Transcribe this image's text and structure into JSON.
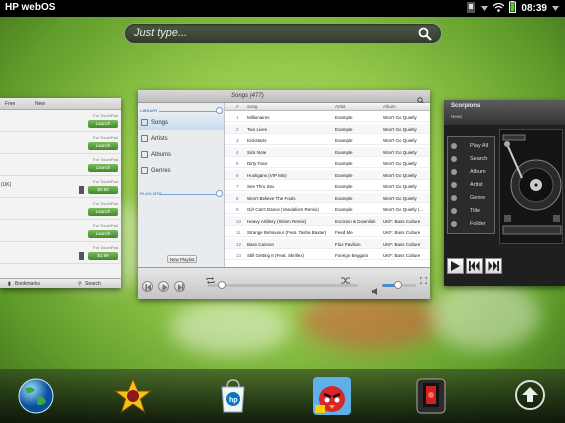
{
  "status_bar": {
    "title": "HP webOS",
    "time": "08:39"
  },
  "search": {
    "placeholder": "Just type..."
  },
  "left_card": {
    "tabs": [
      "Free",
      "New"
    ],
    "rows": [
      {
        "price": "For TouchPad",
        "button": "Launch",
        "side": ""
      },
      {
        "price": "For TouchPad",
        "button": "Launch",
        "side": ""
      },
      {
        "price": "For TouchPad",
        "button": "Launch",
        "side": ""
      },
      {
        "price": "For TouchPad",
        "button": "$0.99",
        "side": "(UK)"
      },
      {
        "price": "For TouchPad",
        "button": "Launch",
        "side": ""
      },
      {
        "price": "For TouchPad",
        "button": "Launch",
        "side": ""
      },
      {
        "price": "For TouchPad",
        "button": "$1.99",
        "side": ""
      }
    ],
    "footer": {
      "bookmarks": "Bookmarks",
      "search": "Search"
    }
  },
  "music": {
    "title": "Songs (477)",
    "sections": {
      "library": "LIBRARY",
      "playlists": "PLAYLISTS"
    },
    "nav": [
      "Songs",
      "Artists",
      "Albums",
      "Genres"
    ],
    "new_playlist": "New Playlist",
    "columns": {
      "num": "#",
      "song": "Song",
      "artist": "Artist",
      "album": "Album"
    },
    "songs": [
      {
        "num": "1",
        "song": "Millionaires",
        "artist": "Example",
        "album": "Won't Go Quietly"
      },
      {
        "num": "2",
        "song": "Two Lives",
        "artist": "Example",
        "album": "Won't Go Quietly"
      },
      {
        "num": "3",
        "song": "Kickstarts",
        "artist": "Example",
        "album": "Won't Go Quietly"
      },
      {
        "num": "4",
        "song": "Sick Note",
        "artist": "Example",
        "album": "Won't Go Quietly"
      },
      {
        "num": "5",
        "song": "Dirty Face",
        "artist": "Example",
        "album": "Won't Go Quietly"
      },
      {
        "num": "6",
        "song": "Hooligans (VIP Mix)",
        "artist": "Example",
        "album": "Won't Go Quietly"
      },
      {
        "num": "7",
        "song": "See Thru Sex",
        "artist": "Example",
        "album": "Won't Go Quietly"
      },
      {
        "num": "8",
        "song": "Won't Believe The Fools",
        "artist": "Example",
        "album": "Won't Go Quietly"
      },
      {
        "num": "9",
        "song": "Girl Can't Dance (Vandalism Remix)",
        "artist": "Example",
        "album": "Won't Go Quietly (..."
      },
      {
        "num": "10",
        "song": "Heavy Artillery (Skism Remix)",
        "artist": "Excision & Downlink",
        "album": "UKF: Bass Culture"
      },
      {
        "num": "11",
        "song": "Strange Behaviour (Feat. Tasha Baxter)",
        "artist": "Feed Me",
        "album": "UKF: Bass Culture"
      },
      {
        "num": "12",
        "song": "Bass Cannon",
        "artist": "Flux Pavilion",
        "album": "UKF: Bass Culture"
      },
      {
        "num": "13",
        "song": "Still Getting It (Feat. Skrillex)",
        "artist": "Foreign Beggars",
        "album": "UKF: Bass Culture"
      }
    ]
  },
  "scorpions": {
    "title": "Scorpions",
    "subtitle": "News",
    "menu": [
      "Play All",
      "Search",
      "Album",
      "Artist",
      "Genre",
      "Title",
      "Folder"
    ]
  },
  "dock": [
    "browser-icon",
    "star-app-icon",
    "hp-app-catalog-icon",
    "angry-birds-hd-icon",
    "jukebox-app-icon",
    "launcher-up-icon"
  ],
  "colors": {
    "accent_blue": "#4a89d0",
    "launch_green": "#3f8a2b",
    "wallpaper_green": "#93c74a"
  }
}
